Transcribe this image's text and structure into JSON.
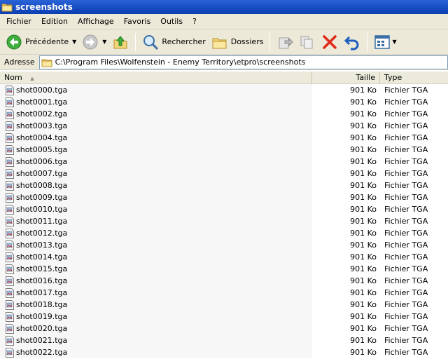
{
  "window": {
    "title": "screenshots"
  },
  "menu": [
    "Fichier",
    "Edition",
    "Affichage",
    "Favoris",
    "Outils",
    "?"
  ],
  "toolbar": {
    "back_label": "Précédente",
    "search_label": "Rechercher",
    "folders_label": "Dossiers"
  },
  "address": {
    "label": "Adresse",
    "path": "C:\\Program Files\\Wolfenstein - Enemy Territory\\etpro\\screenshots"
  },
  "columns": {
    "name": "Nom",
    "size": "Taille",
    "type": "Type"
  },
  "colors": {
    "titlebar": "#0b3fb1",
    "chrome": "#ece9d8",
    "sorted_column": "#f7f7f7"
  },
  "files": [
    {
      "name": "shot0000.tga",
      "size": "901 Ko",
      "type": "Fichier TGA"
    },
    {
      "name": "shot0001.tga",
      "size": "901 Ko",
      "type": "Fichier TGA"
    },
    {
      "name": "shot0002.tga",
      "size": "901 Ko",
      "type": "Fichier TGA"
    },
    {
      "name": "shot0003.tga",
      "size": "901 Ko",
      "type": "Fichier TGA"
    },
    {
      "name": "shot0004.tga",
      "size": "901 Ko",
      "type": "Fichier TGA"
    },
    {
      "name": "shot0005.tga",
      "size": "901 Ko",
      "type": "Fichier TGA"
    },
    {
      "name": "shot0006.tga",
      "size": "901 Ko",
      "type": "Fichier TGA"
    },
    {
      "name": "shot0007.tga",
      "size": "901 Ko",
      "type": "Fichier TGA"
    },
    {
      "name": "shot0008.tga",
      "size": "901 Ko",
      "type": "Fichier TGA"
    },
    {
      "name": "shot0009.tga",
      "size": "901 Ko",
      "type": "Fichier TGA"
    },
    {
      "name": "shot0010.tga",
      "size": "901 Ko",
      "type": "Fichier TGA"
    },
    {
      "name": "shot0011.tga",
      "size": "901 Ko",
      "type": "Fichier TGA"
    },
    {
      "name": "shot0012.tga",
      "size": "901 Ko",
      "type": "Fichier TGA"
    },
    {
      "name": "shot0013.tga",
      "size": "901 Ko",
      "type": "Fichier TGA"
    },
    {
      "name": "shot0014.tga",
      "size": "901 Ko",
      "type": "Fichier TGA"
    },
    {
      "name": "shot0015.tga",
      "size": "901 Ko",
      "type": "Fichier TGA"
    },
    {
      "name": "shot0016.tga",
      "size": "901 Ko",
      "type": "Fichier TGA"
    },
    {
      "name": "shot0017.tga",
      "size": "901 Ko",
      "type": "Fichier TGA"
    },
    {
      "name": "shot0018.tga",
      "size": "901 Ko",
      "type": "Fichier TGA"
    },
    {
      "name": "shot0019.tga",
      "size": "901 Ko",
      "type": "Fichier TGA"
    },
    {
      "name": "shot0020.tga",
      "size": "901 Ko",
      "type": "Fichier TGA"
    },
    {
      "name": "shot0021.tga",
      "size": "901 Ko",
      "type": "Fichier TGA"
    },
    {
      "name": "shot0022.tga",
      "size": "901 Ko",
      "type": "Fichier TGA"
    }
  ]
}
